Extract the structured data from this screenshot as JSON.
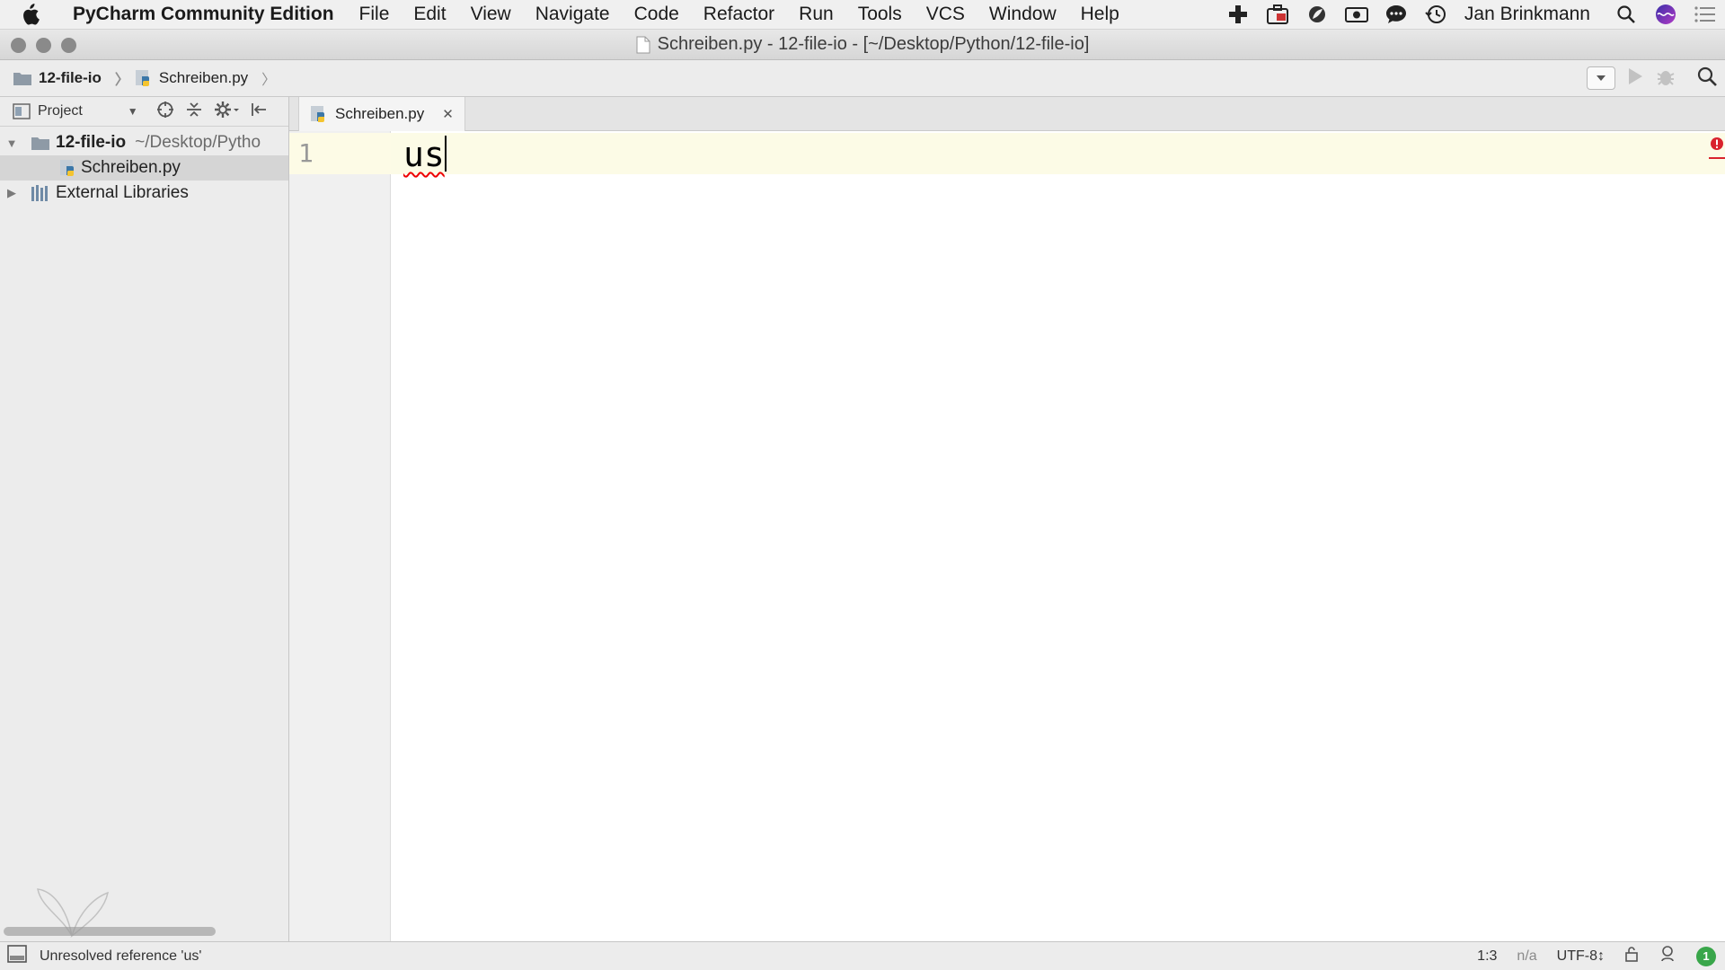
{
  "menubar": {
    "app_name": "PyCharm Community Edition",
    "menus": [
      "File",
      "Edit",
      "View",
      "Navigate",
      "Code",
      "Refactor",
      "Run",
      "Tools",
      "VCS",
      "Window",
      "Help"
    ],
    "user": "Jan Brinkmann",
    "tray_icons": [
      "plus-icon",
      "briefcase-icon",
      "leaf-icon",
      "camera-icon",
      "chat-icon",
      "time-machine-icon",
      "spotlight-icon",
      "siri-icon",
      "notification-list-icon"
    ]
  },
  "window": {
    "title": "Schreiben.py - 12-file-io - [~/Desktop/Python/12-file-io]"
  },
  "navbar": {
    "crumbs": [
      "12-file-io",
      "Schreiben.py"
    ]
  },
  "project_pane": {
    "title": "Project",
    "root": {
      "name": "12-file-io",
      "path": "~/Desktop/Pytho"
    },
    "file": "Schreiben.py",
    "external": "External Libraries"
  },
  "editor": {
    "tab_label": "Schreiben.py",
    "line_number": "1",
    "code": "us"
  },
  "statusbar": {
    "message": "Unresolved reference 'us'",
    "position": "1:3",
    "na": "n/a",
    "encoding": "UTF-8↕",
    "event_count": "1"
  },
  "colors": {
    "error": "#e00000",
    "current_line": "#fcfbe6",
    "ok_badge": "#39a64a"
  }
}
